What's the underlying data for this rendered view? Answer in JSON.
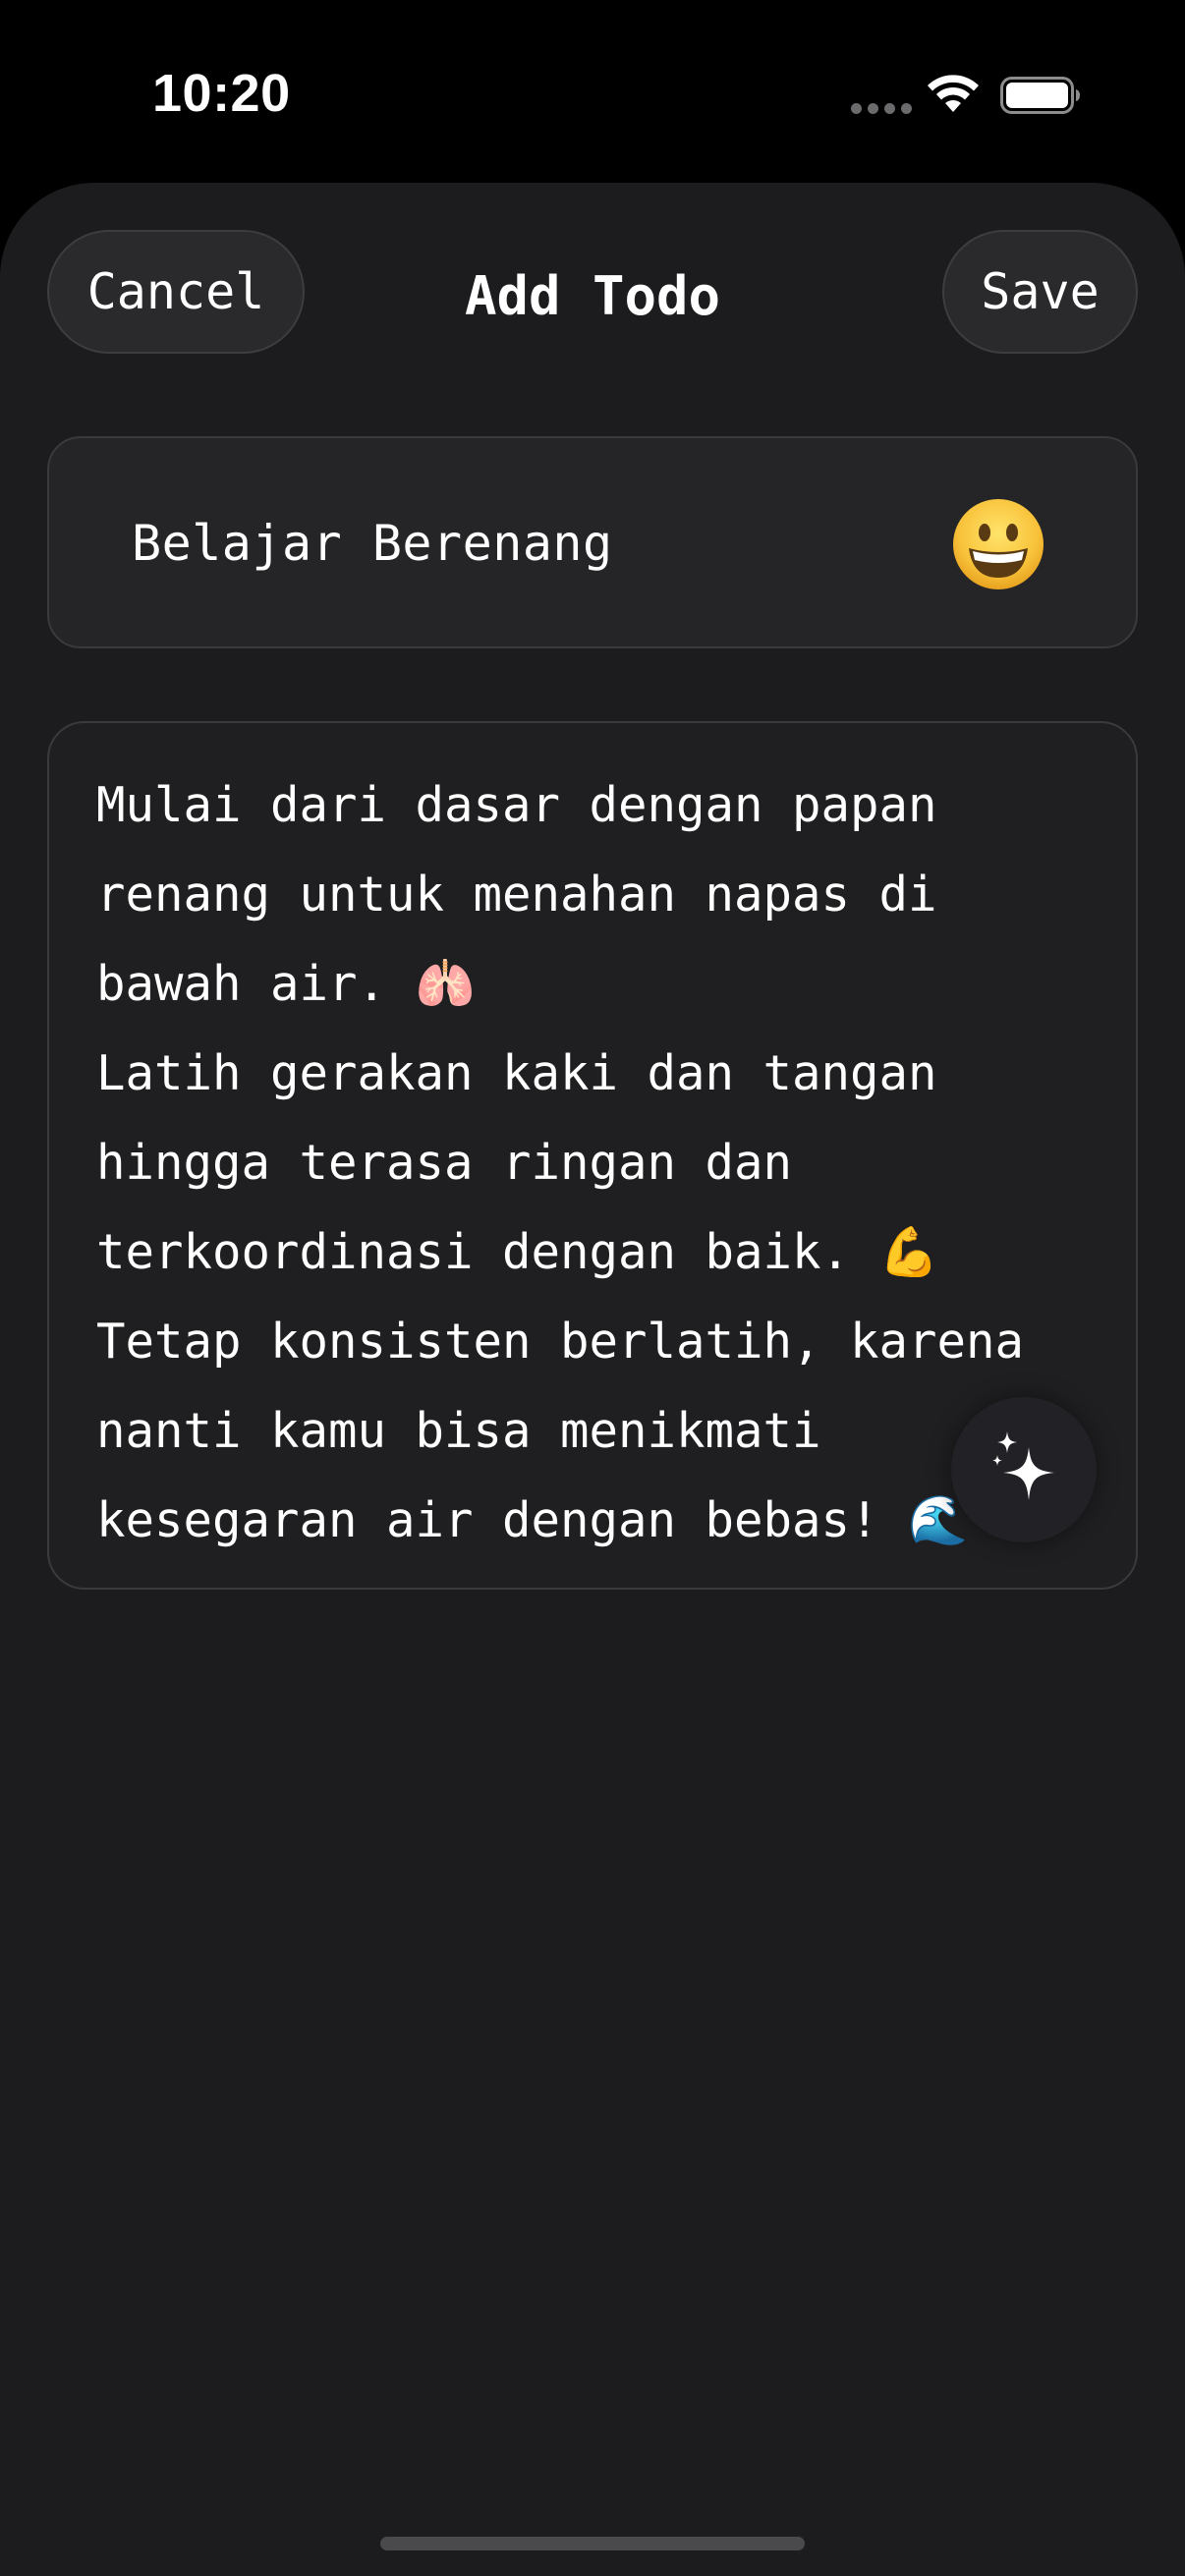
{
  "status_bar": {
    "time": "10:20"
  },
  "header": {
    "title": "Add Todo",
    "cancel_label": "Cancel",
    "save_label": "Save"
  },
  "todo": {
    "title_value": "Belajar Berenang",
    "emoji": "😀",
    "description_value": "Mulai dari dasar dengan papan\nrenang untuk menahan napas di\nbawah air. 🫁\nLatih gerakan kaki dan tangan\nhingga terasa ringan dan\nterkoordinasi dengan baik. 💪\nTetap konsisten berlatih, karena\nnanti kamu bisa menikmati\nkesegaran air dengan bebas! 🌊"
  },
  "icons": {
    "emoji_picker": "grinning-face-icon",
    "ai_assist": "sparkles-icon",
    "wifi": "wifi-icon",
    "battery": "battery-icon"
  },
  "colors": {
    "background": "#000000",
    "sheet": "#1c1c1e",
    "card": "#252527",
    "border": "#3a3a3e",
    "text": "#ffffff"
  }
}
